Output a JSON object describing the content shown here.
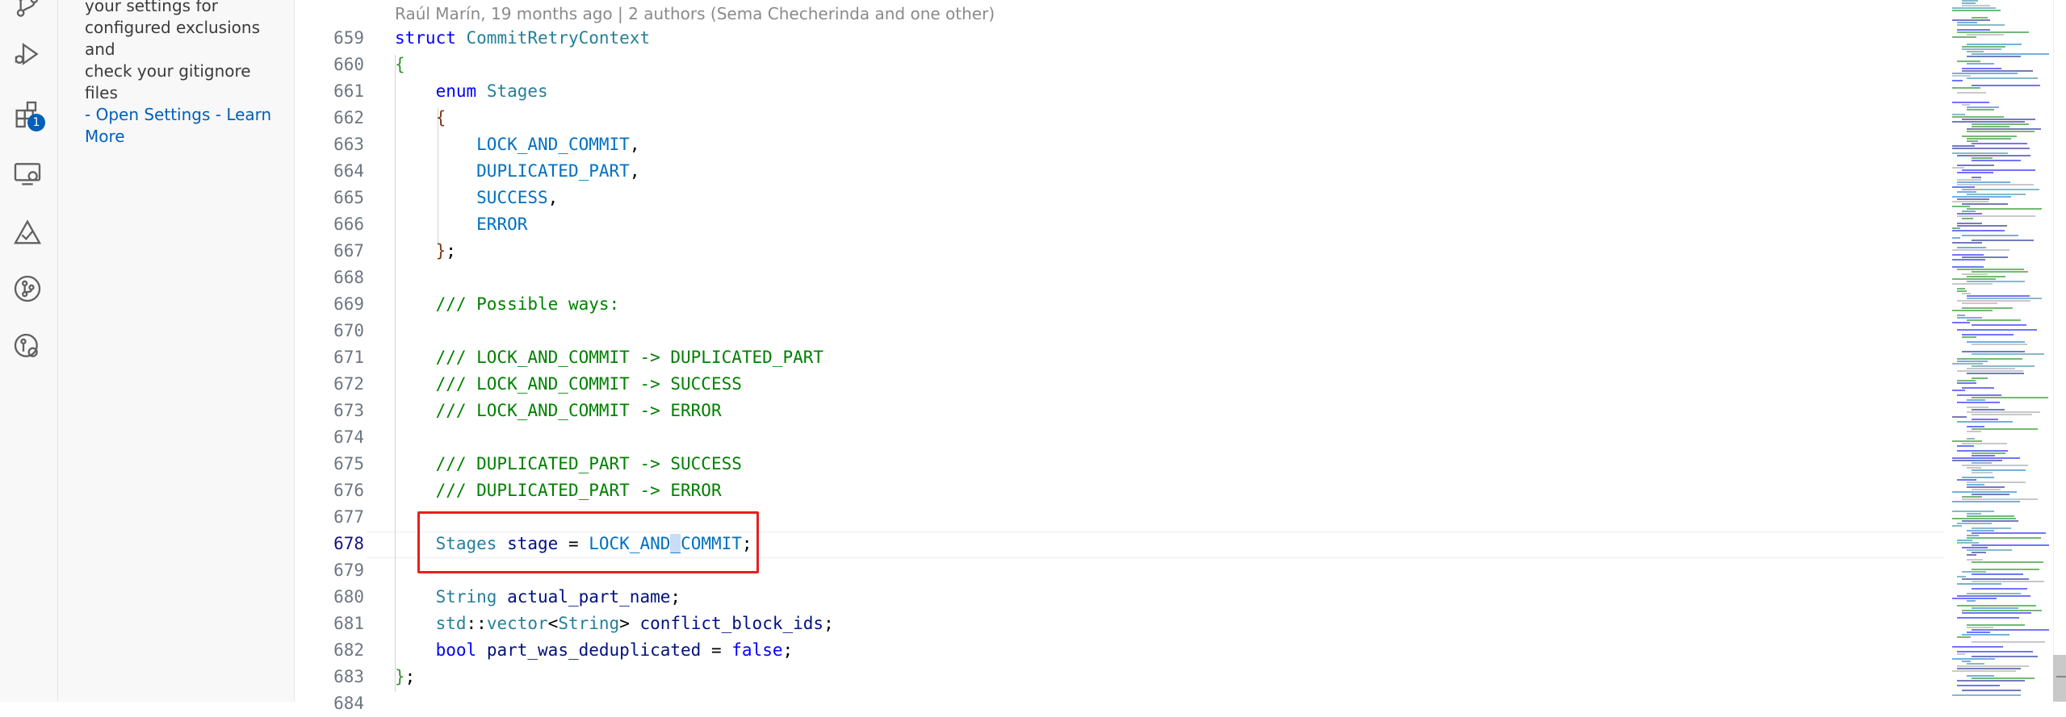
{
  "activity_bar": {
    "icons": [
      "source-control-icon",
      "run-debug-icon",
      "extensions-icon",
      "remote-explorer-icon",
      "testing-icon",
      "git-graph-icon",
      "gitlens-icon"
    ],
    "extensions_badge": "1"
  },
  "sidebar": {
    "message_lines": [
      "your settings for",
      "configured exclusions and",
      "check your gitignore files"
    ],
    "link_prefix": "- ",
    "open_settings": "Open Settings",
    "link_separator": " - ",
    "learn": "Learn",
    "more": "More"
  },
  "editor": {
    "blame": "Raúl Marín, 19 months ago | 2 authors (Sema Checherinda and one other)",
    "lines": [
      {
        "num": "659",
        "tokens": [
          [
            "kw",
            "struct"
          ],
          [
            "plain",
            " "
          ],
          [
            "type",
            "CommitRetryContext"
          ]
        ]
      },
      {
        "num": "660",
        "tokens": [
          [
            "brace",
            "{"
          ]
        ]
      },
      {
        "num": "661",
        "tokens": [
          [
            "plain",
            "    "
          ],
          [
            "kw",
            "enum"
          ],
          [
            "plain",
            " "
          ],
          [
            "type",
            "Stages"
          ]
        ]
      },
      {
        "num": "662",
        "tokens": [
          [
            "plain",
            "    "
          ],
          [
            "brace2",
            "{"
          ]
        ]
      },
      {
        "num": "663",
        "tokens": [
          [
            "plain",
            "        "
          ],
          [
            "enum",
            "LOCK_AND_COMMIT"
          ],
          [
            "plain",
            ","
          ]
        ]
      },
      {
        "num": "664",
        "tokens": [
          [
            "plain",
            "        "
          ],
          [
            "enum",
            "DUPLICATED_PART"
          ],
          [
            "plain",
            ","
          ]
        ]
      },
      {
        "num": "665",
        "tokens": [
          [
            "plain",
            "        "
          ],
          [
            "enum",
            "SUCCESS"
          ],
          [
            "plain",
            ","
          ]
        ]
      },
      {
        "num": "666",
        "tokens": [
          [
            "plain",
            "        "
          ],
          [
            "enum",
            "ERROR"
          ]
        ]
      },
      {
        "num": "667",
        "tokens": [
          [
            "plain",
            "    "
          ],
          [
            "brace2",
            "}"
          ],
          [
            "plain",
            ";"
          ]
        ]
      },
      {
        "num": "668",
        "tokens": []
      },
      {
        "num": "669",
        "tokens": [
          [
            "plain",
            "    "
          ],
          [
            "cmt",
            "/// Possible ways:"
          ]
        ]
      },
      {
        "num": "670",
        "tokens": []
      },
      {
        "num": "671",
        "tokens": [
          [
            "plain",
            "    "
          ],
          [
            "cmt",
            "/// LOCK_AND_COMMIT -> DUPLICATED_PART"
          ]
        ]
      },
      {
        "num": "672",
        "tokens": [
          [
            "plain",
            "    "
          ],
          [
            "cmt",
            "/// LOCK_AND_COMMIT -> SUCCESS"
          ]
        ]
      },
      {
        "num": "673",
        "tokens": [
          [
            "plain",
            "    "
          ],
          [
            "cmt",
            "/// LOCK_AND_COMMIT -> ERROR"
          ]
        ]
      },
      {
        "num": "674",
        "tokens": []
      },
      {
        "num": "675",
        "tokens": [
          [
            "plain",
            "    "
          ],
          [
            "cmt",
            "/// DUPLICATED_PART -> SUCCESS"
          ]
        ]
      },
      {
        "num": "676",
        "tokens": [
          [
            "plain",
            "    "
          ],
          [
            "cmt",
            "/// DUPLICATED_PART -> ERROR"
          ]
        ]
      },
      {
        "num": "677",
        "tokens": []
      },
      {
        "num": "678",
        "tokens": [
          [
            "plain",
            "    "
          ],
          [
            "type",
            "Stages"
          ],
          [
            "plain",
            " "
          ],
          [
            "var",
            "stage"
          ],
          [
            "plain",
            " = "
          ],
          [
            "enum",
            "LOCK_AND"
          ],
          [
            "enumsel",
            "_"
          ],
          [
            "enum",
            "COMMIT"
          ],
          [
            "plain",
            ";"
          ]
        ],
        "active": true
      },
      {
        "num": "679",
        "tokens": []
      },
      {
        "num": "680",
        "tokens": [
          [
            "plain",
            "    "
          ],
          [
            "type",
            "String"
          ],
          [
            "plain",
            " "
          ],
          [
            "var",
            "actual_part_name"
          ],
          [
            "plain",
            ";"
          ]
        ]
      },
      {
        "num": "681",
        "tokens": [
          [
            "plain",
            "    "
          ],
          [
            "type",
            "std"
          ],
          [
            "plain",
            "::"
          ],
          [
            "type",
            "vector"
          ],
          [
            "plain",
            "<"
          ],
          [
            "type",
            "String"
          ],
          [
            "plain",
            "> "
          ],
          [
            "var",
            "conflict_block_ids"
          ],
          [
            "plain",
            ";"
          ]
        ]
      },
      {
        "num": "682",
        "tokens": [
          [
            "plain",
            "    "
          ],
          [
            "kw",
            "bool"
          ],
          [
            "plain",
            " "
          ],
          [
            "var",
            "part_was_deduplicated"
          ],
          [
            "plain",
            " = "
          ],
          [
            "kw",
            "false"
          ],
          [
            "plain",
            ";"
          ]
        ]
      },
      {
        "num": "683",
        "tokens": [
          [
            "brace",
            "}"
          ],
          [
            "plain",
            ";"
          ]
        ]
      },
      {
        "num": "684",
        "tokens": []
      }
    ]
  },
  "colors": {
    "accent": "#005fb8",
    "highlight_box": "#e81e1e"
  }
}
